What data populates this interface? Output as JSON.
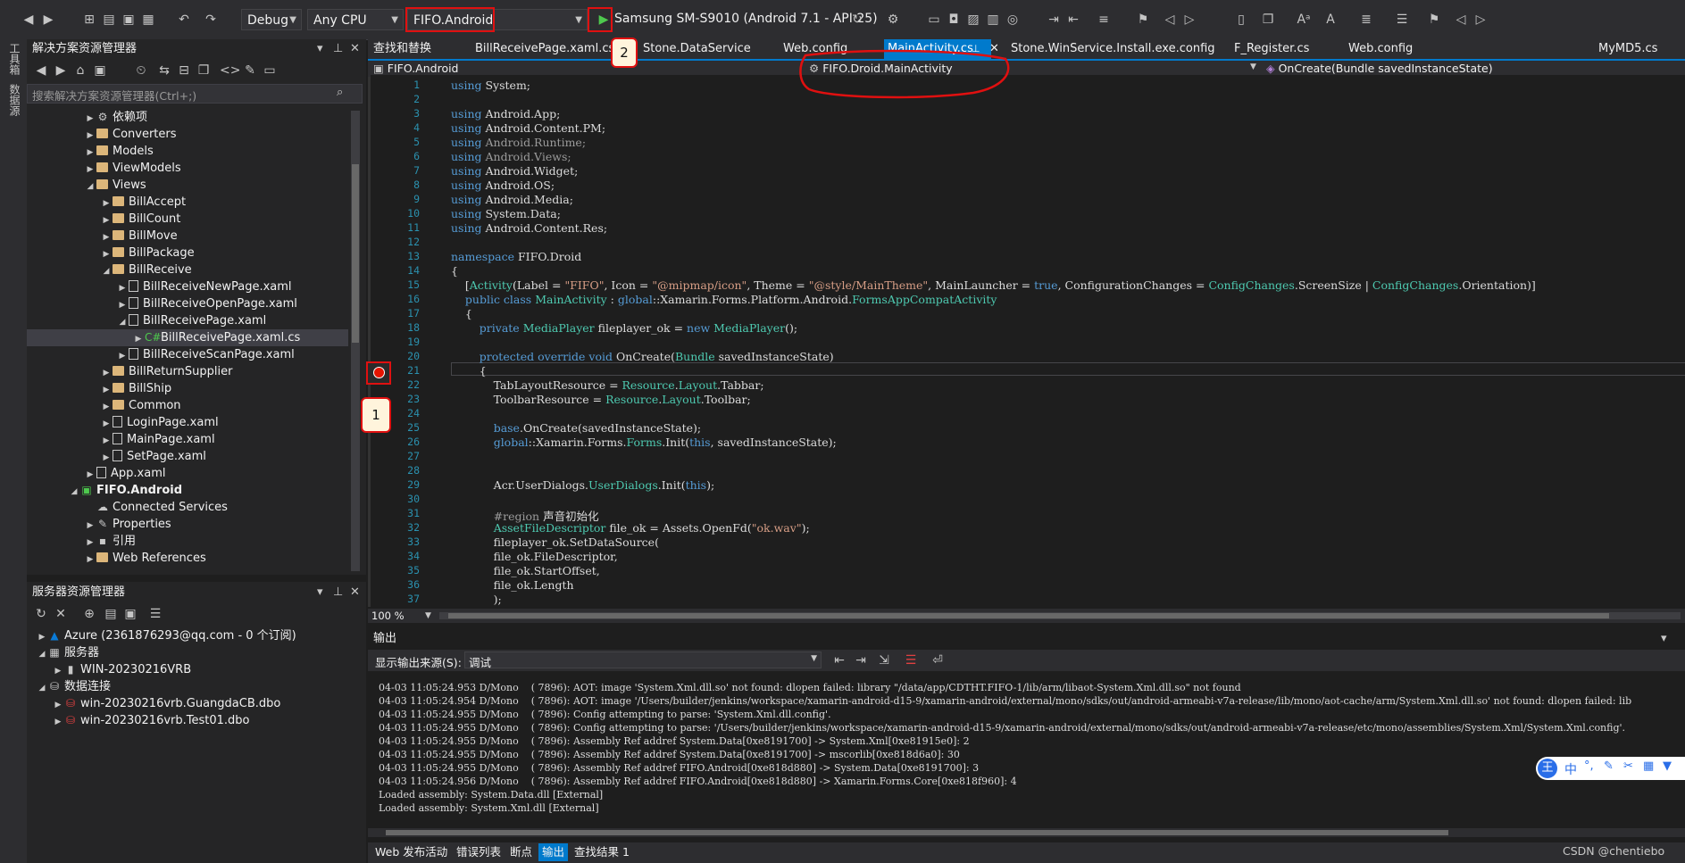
{
  "toolbar": {
    "config": "Debug",
    "platform": "Any CPU",
    "startup_project": "FIFO.Android",
    "device": "Samsung SM-S9010 (Android 7.1 - API 25)"
  },
  "side_strip": [
    "工具箱",
    "数据源"
  ],
  "solution_explorer": {
    "title": "解决方案资源管理器",
    "search_placeholder": "搜索解决方案资源管理器(Ctrl+;)",
    "items": [
      {
        "label": "依赖项",
        "kind": "dep"
      },
      {
        "label": "Converters",
        "kind": "folder"
      },
      {
        "label": "Models",
        "kind": "folder"
      },
      {
        "label": "ViewModels",
        "kind": "folder"
      },
      {
        "label": "Views",
        "kind": "folder"
      },
      {
        "label": "BillAccept",
        "kind": "folder"
      },
      {
        "label": "BillCount",
        "kind": "folder"
      },
      {
        "label": "BillMove",
        "kind": "folder"
      },
      {
        "label": "BillPackage",
        "kind": "folder"
      },
      {
        "label": "BillReceive",
        "kind": "folder"
      },
      {
        "label": "BillReceiveNewPage.xaml",
        "kind": "file"
      },
      {
        "label": "BillReceiveOpenPage.xaml",
        "kind": "file"
      },
      {
        "label": "BillReceivePage.xaml",
        "kind": "file"
      },
      {
        "label": "BillReceivePage.xaml.cs",
        "kind": "cs"
      },
      {
        "label": "BillReceiveScanPage.xaml",
        "kind": "file"
      },
      {
        "label": "BillReturnSupplier",
        "kind": "folder"
      },
      {
        "label": "BillShip",
        "kind": "folder"
      },
      {
        "label": "Common",
        "kind": "folder"
      },
      {
        "label": "LoginPage.xaml",
        "kind": "file"
      },
      {
        "label": "MainPage.xaml",
        "kind": "file"
      },
      {
        "label": "SetPage.xaml",
        "kind": "file"
      },
      {
        "label": "App.xaml",
        "kind": "file"
      },
      {
        "label": "FIFO.Android",
        "kind": "project"
      },
      {
        "label": "Connected Services",
        "kind": "svc"
      },
      {
        "label": "Properties",
        "kind": "prop"
      },
      {
        "label": "引用",
        "kind": "ref"
      },
      {
        "label": "Web References",
        "kind": "folder"
      }
    ]
  },
  "server_explorer": {
    "title": "服务器资源管理器",
    "items": [
      {
        "label": "Azure (2361876293@qq.com - 0 个订阅)"
      },
      {
        "label": "服务器"
      },
      {
        "label": "WIN-20230216VRB"
      },
      {
        "label": "数据连接"
      },
      {
        "label": "win-20230216vrb.GuangdaCB.dbo"
      },
      {
        "label": "win-20230216vrb.Test01.dbo"
      }
    ]
  },
  "tabs": {
    "find_replace": "查找和替换",
    "items": [
      "BillReceivePage.xaml.cs",
      "Stone.DataService",
      "Web.config",
      "MainActivity.cs",
      "Stone.WinService.Install.exe.config",
      "F_Register.cs",
      "Web.config",
      "MyMD5.cs"
    ]
  },
  "navbar": {
    "project": "FIFO.Android",
    "class": "FIFO.Droid.MainActivity",
    "member": "OnCreate(Bundle savedInstanceState)"
  },
  "annotations": {
    "one": "1",
    "two": "2"
  },
  "code": {
    "line_numbers": [
      "1",
      "2",
      "3",
      "4",
      "5",
      "6",
      "7",
      "8",
      "9",
      "10",
      "11",
      "12",
      "13",
      "14",
      "15",
      "16",
      "17",
      "18",
      "19",
      "20",
      "21",
      "22",
      "23",
      "24",
      "25",
      "26",
      "27",
      "28",
      "29",
      "30",
      "31",
      "32",
      "33",
      "34",
      "35",
      "36",
      "37"
    ],
    "breakpoint_line": "21"
  },
  "editor_status": {
    "zoom": "100 %"
  },
  "output": {
    "title": "输出",
    "source_label": "显示输出来源(S):",
    "source_value": "调试",
    "lines": [
      "04-03 11:05:24.953 D/Mono    ( 7896): AOT: image 'System.Xml.dll.so' not found: dlopen failed: library \"/data/app/CDTHT.FIFO-1/lib/arm/libaot-System.Xml.dll.so\" not found",
      "04-03 11:05:24.954 D/Mono    ( 7896): AOT: image '/Users/builder/jenkins/workspace/xamarin-android-d15-9/xamarin-android/external/mono/sdks/out/android-armeabi-v7a-release/lib/mono/aot-cache/arm/System.Xml.dll.so' not found: dlopen failed: lib",
      "04-03 11:05:24.955 D/Mono    ( 7896): Config attempting to parse: 'System.Xml.dll.config'.",
      "04-03 11:05:24.955 D/Mono    ( 7896): Config attempting to parse: '/Users/builder/jenkins/workspace/xamarin-android-d15-9/xamarin-android/external/mono/sdks/out/android-armeabi-v7a-release/etc/mono/assemblies/System.Xml/System.Xml.config'.",
      "04-03 11:05:24.955 D/Mono    ( 7896): Assembly Ref addref System.Data[0xe8191700] -> System.Xml[0xe81915e0]: 2",
      "04-03 11:05:24.955 D/Mono    ( 7896): Assembly Ref addref System.Data[0xe8191700] -> mscorlib[0xe818d6a0]: 30",
      "04-03 11:05:24.955 D/Mono    ( 7896): Assembly Ref addref FIFO.Android[0xe818d880] -> System.Data[0xe8191700]: 3",
      "04-03 11:05:24.956 D/Mono    ( 7896): Assembly Ref addref FIFO.Android[0xe818d880] -> Xamarin.Forms.Core[0xe818f960]: 4",
      "Loaded assembly: System.Data.dll [External]",
      "Loaded assembly: System.Xml.dll [External]"
    ]
  },
  "bottom_tabs": [
    "Web 发布活动",
    "错误列表",
    "断点",
    "输出",
    "查找结果 1"
  ],
  "watermark": "CSDN @chentiebo",
  "ime": "中"
}
